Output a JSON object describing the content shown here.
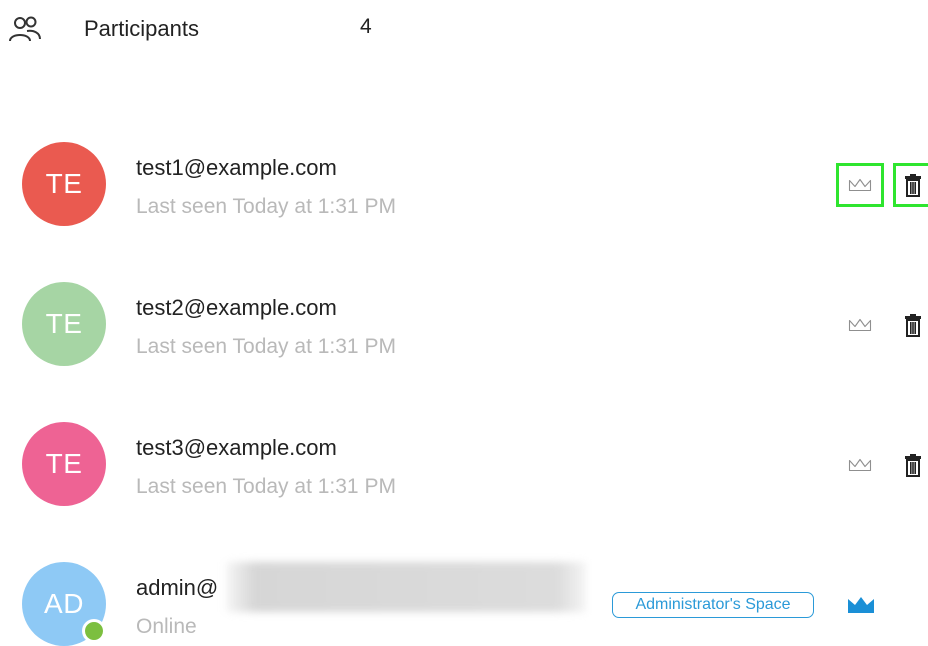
{
  "header": {
    "icon": "people-icon",
    "title": "Participants",
    "count": "4"
  },
  "colors": {
    "avatar_test1": "#ea5a50",
    "avatar_test2": "#a6d5a4",
    "avatar_test3": "#ee6394",
    "avatar_admin": "#8ec9f5",
    "online_dot": "#7cbf3f",
    "highlight": "#2ee52e",
    "badge": "#2b9ad8"
  },
  "participants": [
    {
      "initials": "TE",
      "email": "test1@example.com",
      "status": "Last seen Today at 1:31 PM",
      "actions": [
        "crown-icon",
        "trash-icon"
      ]
    },
    {
      "initials": "TE",
      "email": "test2@example.com",
      "status": "Last seen Today at 1:31 PM",
      "actions": [
        "crown-icon",
        "trash-icon"
      ]
    },
    {
      "initials": "TE",
      "email": "test3@example.com",
      "status": "Last seen Today at 1:31 PM",
      "actions": [
        "crown-icon",
        "trash-icon"
      ]
    },
    {
      "initials": "AD",
      "email": "admin@",
      "status": "Online",
      "badge": "Administrator's Space",
      "actions": [
        "crown-filled-icon"
      ]
    }
  ]
}
